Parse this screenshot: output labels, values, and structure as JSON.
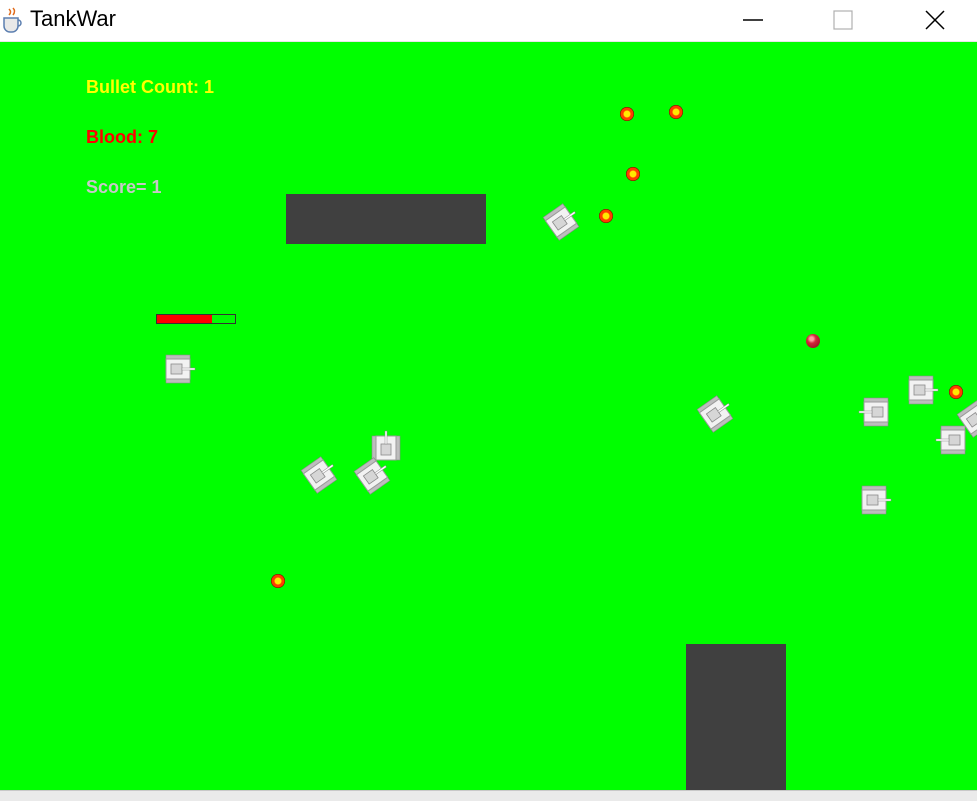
{
  "window": {
    "title": "TankWar"
  },
  "hud": {
    "bullet_count": "Bullet Count: 1",
    "blood": "Blood: 7",
    "score": "Score= 1"
  },
  "player": {
    "health_fraction": 0.7
  },
  "colors": {
    "field": "#00ff00",
    "wall": "#404040",
    "bullet_count_text": "#ffff00",
    "blood_text": "#ff0000",
    "score_text": "#c8c8c8"
  },
  "icons": {
    "app": "java-cup-icon",
    "minimize": "minimize-icon",
    "maximize": "maximize-icon",
    "close": "close-icon"
  }
}
